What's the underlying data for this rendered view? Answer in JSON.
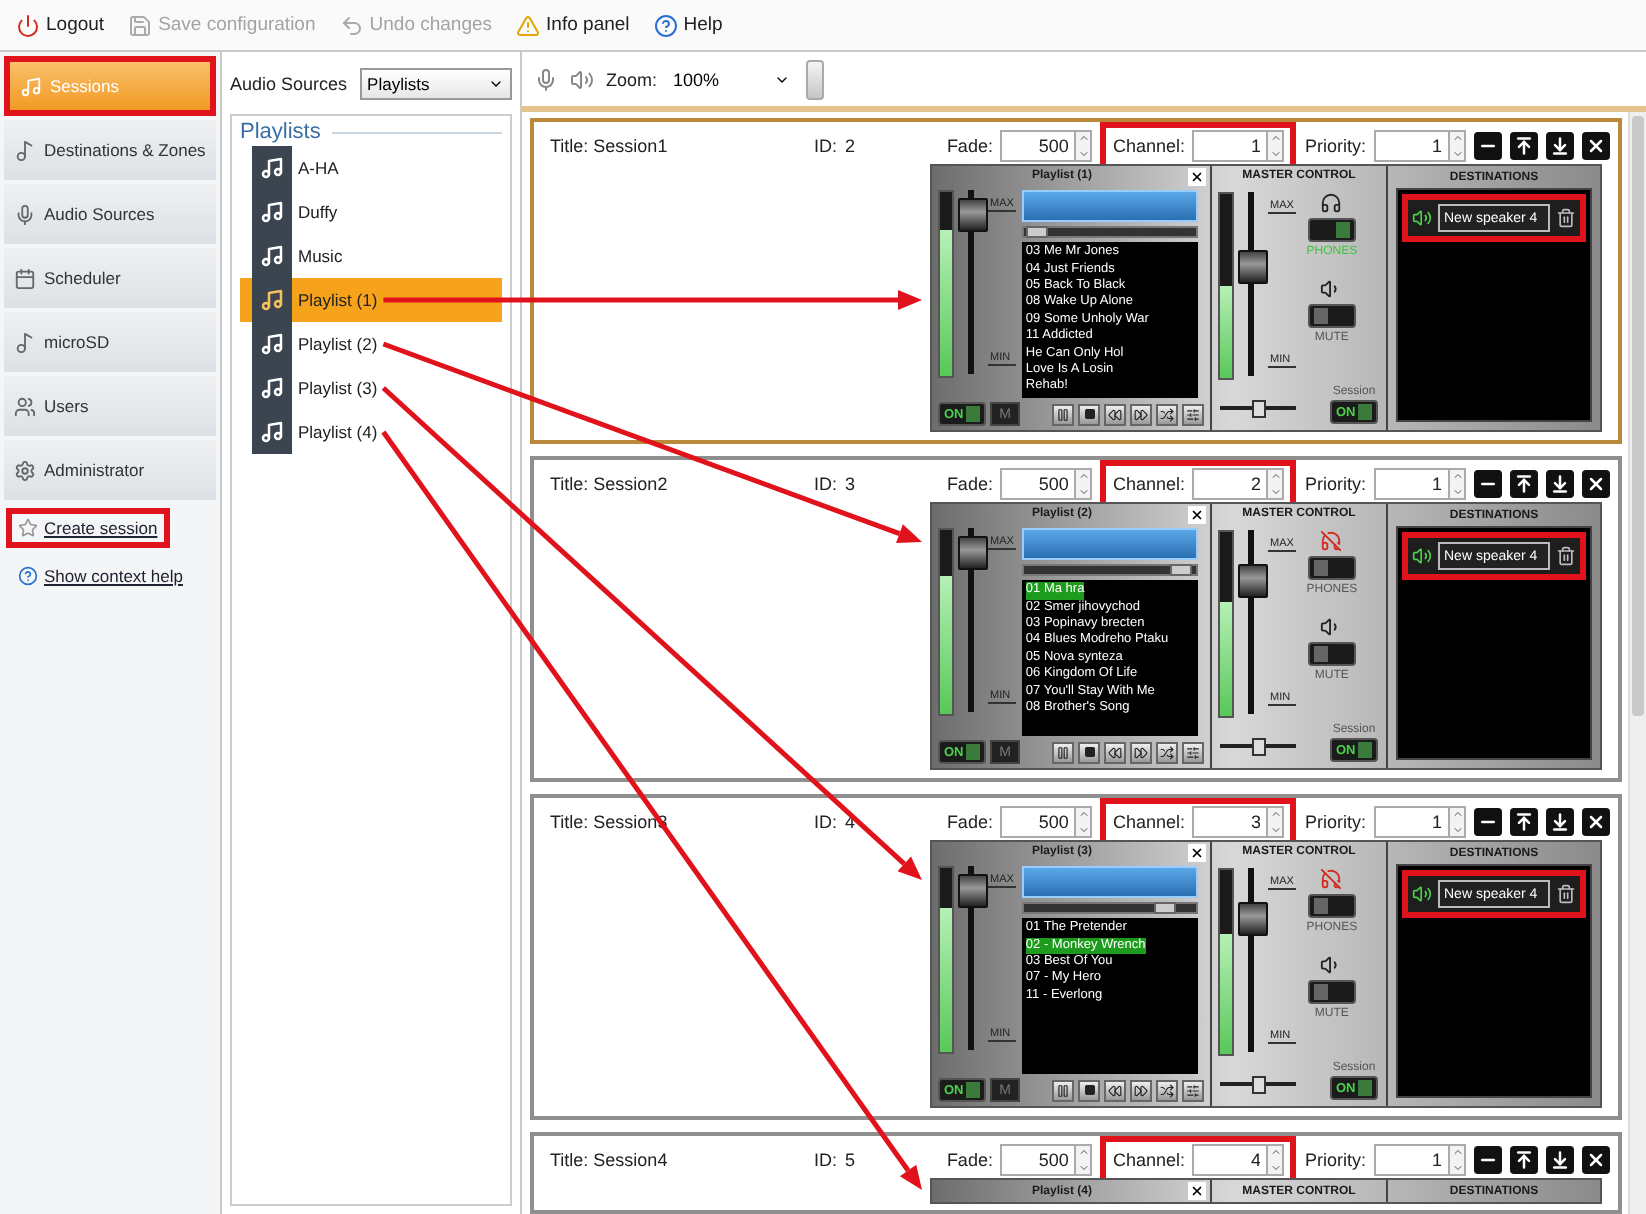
{
  "toolbar": [
    {
      "kind": "logout",
      "label": "Logout",
      "disabled": false
    },
    {
      "kind": "save",
      "label": "Save configuration",
      "disabled": true
    },
    {
      "kind": "undo",
      "label": "Undo changes",
      "disabled": true
    },
    {
      "kind": "info",
      "label": "Info panel",
      "disabled": false
    },
    {
      "kind": "help",
      "label": "Help",
      "disabled": false
    }
  ],
  "sidebar": {
    "items": [
      {
        "kind": "sessions",
        "label": "Sessions",
        "selected": true,
        "annotated": true
      },
      {
        "kind": "destinations",
        "label": "Destinations & Zones",
        "selected": false,
        "annotated": false
      },
      {
        "kind": "sources",
        "label": "Audio Sources",
        "selected": false,
        "annotated": false
      },
      {
        "kind": "scheduler",
        "label": "Scheduler",
        "selected": false,
        "annotated": false
      },
      {
        "kind": "microsd",
        "label": "microSD",
        "selected": false,
        "annotated": false
      },
      {
        "kind": "users",
        "label": "Users",
        "selected": false,
        "annotated": false
      },
      {
        "kind": "admin",
        "label": "Administrator",
        "selected": false,
        "annotated": false
      }
    ],
    "links": [
      {
        "kind": "create",
        "label": "Create session",
        "annotated": true
      },
      {
        "kind": "help",
        "label": "Show context help",
        "annotated": false
      }
    ]
  },
  "sources": {
    "label": "Audio Sources",
    "dropdown": "Playlists",
    "heading": "Playlists",
    "items": [
      {
        "label": "A-HA",
        "selected": false,
        "annotated": false
      },
      {
        "label": "Duffy",
        "selected": false,
        "annotated": false
      },
      {
        "label": "Music",
        "selected": false,
        "annotated": false
      },
      {
        "label": "Playlist (1)",
        "selected": true,
        "annotated": true
      },
      {
        "label": "Playlist (2)",
        "selected": false,
        "annotated": true
      },
      {
        "label": "Playlist (3)",
        "selected": false,
        "annotated": true
      },
      {
        "label": "Playlist (4)",
        "selected": false,
        "annotated": true
      }
    ]
  },
  "main_toolbar": {
    "zoom_label": "Zoom:",
    "zoom_value": "100%"
  },
  "sessions": [
    {
      "title": "Title: Session1",
      "id_label": "ID:",
      "id": "2",
      "fade_label": "Fade:",
      "fade": "500",
      "channel_label": "Channel:",
      "channel": "1",
      "channel_annotated": true,
      "priority_label": "Priority:",
      "priority": "1",
      "selected": true,
      "mixer": {
        "player": {
          "title": "Playlist (1)",
          "max": "MAX",
          "min": "MIN",
          "meter": {
            "level": 0.8
          },
          "fader": {
            "level": 0.92
          },
          "progress": {
            "level": 0.02
          },
          "tracks": [
            {
              "label": "03 Me  Mr Jones",
              "selected": false
            },
            {
              "label": "04 Just Friends",
              "selected": false
            },
            {
              "label": "05 Back To Black",
              "selected": false
            },
            {
              "label": "08 Wake Up Alone",
              "selected": false
            },
            {
              "label": "09 Some Unholy War",
              "selected": false
            },
            {
              "label": "11 Addicted",
              "selected": false
            },
            {
              "label": "He Can Only Hol",
              "selected": false
            },
            {
              "label": "Love Is A Losin",
              "selected": false
            },
            {
              "label": "Rehab!",
              "selected": false
            }
          ],
          "on_toggle": {
            "label": "ON",
            "on": true
          },
          "mute_button": "M"
        },
        "master": {
          "title": "MASTER CONTROL",
          "max": "MAX",
          "min": "MIN",
          "meter": {
            "level": 0.5
          },
          "fader": {
            "level": 0.6
          },
          "phones": {
            "label": "PHONES",
            "on": true
          },
          "mute": {
            "label": "MUTE",
            "on": false
          },
          "balance": {
            "level": 0.5
          },
          "session_label": "Session",
          "session_toggle": {
            "label": "ON",
            "on": true
          }
        },
        "destinations": {
          "title": "DESTINATIONS",
          "items": [
            {
              "name": "New speaker 4",
              "annotated": true
            }
          ]
        }
      }
    },
    {
      "title": "Title: Session2",
      "id_label": "ID:",
      "id": "3",
      "fade_label": "Fade:",
      "fade": "500",
      "channel_label": "Channel:",
      "channel": "2",
      "channel_annotated": true,
      "priority_label": "Priority:",
      "priority": "1",
      "selected": false,
      "mixer": {
        "player": {
          "title": "Playlist (2)",
          "max": "MAX",
          "min": "MIN",
          "meter": {
            "level": 0.75
          },
          "fader": {
            "level": 0.92
          },
          "progress": {
            "level": 0.95
          },
          "tracks": [
            {
              "label": "01 Ma hra",
              "selected": true
            },
            {
              "label": "02 Smer jihovychod",
              "selected": false
            },
            {
              "label": "03 Popinavy brecten",
              "selected": false
            },
            {
              "label": "04 Blues Modreho Ptaku",
              "selected": false
            },
            {
              "label": "05 Nova synteza",
              "selected": false
            },
            {
              "label": "06 Kingdom Of Life",
              "selected": false
            },
            {
              "label": "07 You'll Stay With Me",
              "selected": false
            },
            {
              "label": "08 Brother's Song",
              "selected": false
            }
          ],
          "on_toggle": {
            "label": "ON",
            "on": true
          },
          "mute_button": "M"
        },
        "master": {
          "title": "MASTER CONTROL",
          "max": "MAX",
          "min": "MIN",
          "meter": {
            "level": 0.62
          },
          "fader": {
            "level": 0.75
          },
          "phones": {
            "label": "PHONES",
            "on": false
          },
          "mute": {
            "label": "MUTE",
            "on": false
          },
          "balance": {
            "level": 0.5
          },
          "session_label": "Session",
          "session_toggle": {
            "label": "ON",
            "on": true
          }
        },
        "destinations": {
          "title": "DESTINATIONS",
          "items": [
            {
              "name": "New speaker 4",
              "annotated": true
            }
          ]
        }
      }
    },
    {
      "title": "Title: Session3",
      "id_label": "ID:",
      "id": "4",
      "fade_label": "Fade:",
      "fade": "500",
      "channel_label": "Channel:",
      "channel": "3",
      "channel_annotated": true,
      "priority_label": "Priority:",
      "priority": "1",
      "selected": false,
      "mixer": {
        "player": {
          "title": "Playlist (3)",
          "max": "MAX",
          "min": "MIN",
          "meter": {
            "level": 0.78
          },
          "fader": {
            "level": 0.92
          },
          "progress": {
            "level": 0.85
          },
          "tracks": [
            {
              "label": "01 The Pretender",
              "selected": false
            },
            {
              "label": "02 - Monkey Wrench",
              "selected": true
            },
            {
              "label": "03 Best Of You",
              "selected": false
            },
            {
              "label": "07 - My Hero",
              "selected": false
            },
            {
              "label": "11 - Everlong",
              "selected": false
            }
          ],
          "on_toggle": {
            "label": "ON",
            "on": true
          },
          "mute_button": "M"
        },
        "master": {
          "title": "MASTER CONTROL",
          "max": "MAX",
          "min": "MIN",
          "meter": {
            "level": 0.65
          },
          "fader": {
            "level": 0.75
          },
          "phones": {
            "label": "PHONES",
            "on": false
          },
          "mute": {
            "label": "MUTE",
            "on": false
          },
          "balance": {
            "level": 0.5
          },
          "session_label": "Session",
          "session_toggle": {
            "label": "ON",
            "on": true
          }
        },
        "destinations": {
          "title": "DESTINATIONS",
          "items": [
            {
              "name": "New speaker 4",
              "annotated": true
            }
          ]
        }
      }
    },
    {
      "title": "Title: Session4",
      "id_label": "ID:",
      "id": "5",
      "fade_label": "Fade:",
      "fade": "500",
      "channel_label": "Channel:",
      "channel": "4",
      "channel_annotated": true,
      "priority_label": "Priority:",
      "priority": "1",
      "selected": false,
      "mixer": {
        "player": {
          "title": "Playlist (4)"
        },
        "master": {
          "title": "MASTER CONTROL"
        },
        "destinations": {
          "title": "DESTINATIONS"
        }
      }
    }
  ]
}
